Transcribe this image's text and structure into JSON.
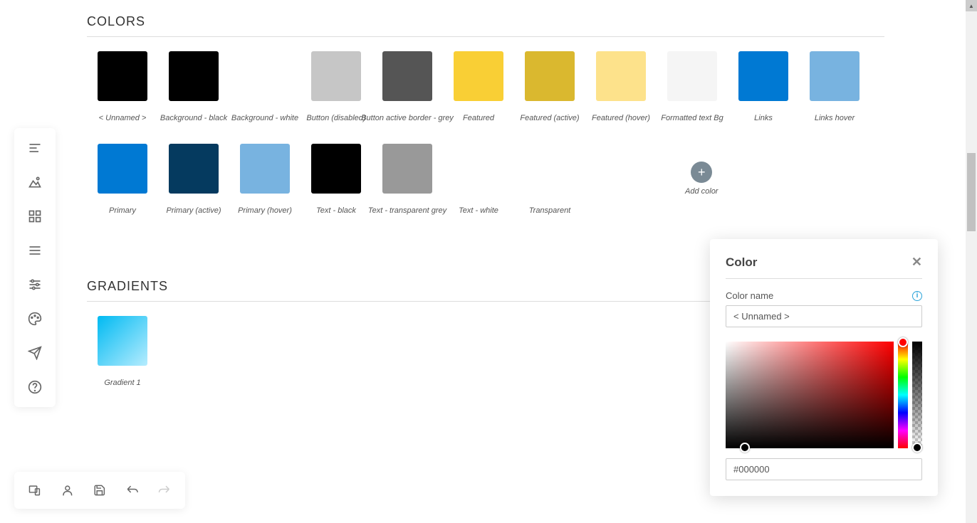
{
  "sections": {
    "colors_title": "COLORS",
    "gradients_title": "GRADIENTS"
  },
  "colors": [
    {
      "label": "< Unnamed >",
      "hex": "#000000"
    },
    {
      "label": "Background - black",
      "hex": "#000000"
    },
    {
      "label": "Background - white",
      "hex": "#ffffff"
    },
    {
      "label": "Button (disabled)",
      "hex": "#c6c6c6"
    },
    {
      "label": "Button active border - grey",
      "hex": "#555555"
    },
    {
      "label": "Featured",
      "hex": "#f9cf35"
    },
    {
      "label": "Featured (active)",
      "hex": "#dab82f"
    },
    {
      "label": "Featured (hover)",
      "hex": "#fde28b"
    },
    {
      "label": "Formatted text Bg",
      "hex": "#f5f5f5"
    },
    {
      "label": "Links",
      "hex": "#0079d3"
    },
    {
      "label": "Links hover",
      "hex": "#78b3e0"
    },
    {
      "label": "Primary",
      "hex": "#0079d3"
    },
    {
      "label": "Primary (active)",
      "hex": "#053a5f"
    },
    {
      "label": "Primary (hover)",
      "hex": "#78b3e0"
    },
    {
      "label": "Text - black",
      "hex": "#000000"
    },
    {
      "label": "Text - transparent grey",
      "hex": "#999999"
    },
    {
      "label": "Text - white",
      "hex": "#ffffff"
    },
    {
      "label": "Transparent",
      "hex": "transparent"
    }
  ],
  "add_color_label": "Add color",
  "gradients": [
    {
      "label": "Gradient 1"
    }
  ],
  "color_panel": {
    "title": "Color",
    "name_label": "Color name",
    "name_value": "< Unnamed >",
    "hex_value": "#000000"
  }
}
